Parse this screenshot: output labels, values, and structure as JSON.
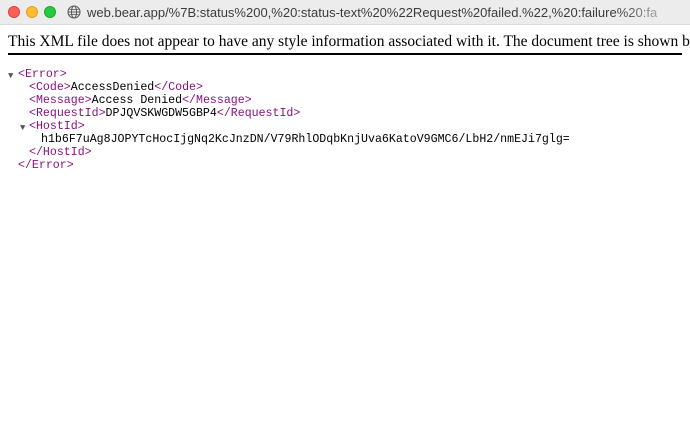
{
  "browser": {
    "url": "web.bear.app/%7B:status%200,%20:status-text%20%22Request%20failed.%22,%20:failure%20:fa",
    "icons": {
      "globe": "globe-icon"
    }
  },
  "page": {
    "notice": "This XML file does not appear to have any style information associated with it. The document tree is shown below."
  },
  "xml": {
    "error_open": "<Error>",
    "error_close": "</Error>",
    "code_open": "<Code>",
    "code_value": "AccessDenied",
    "code_close": "</Code>",
    "message_open": "<Message>",
    "message_value": "Access Denied",
    "message_close": "</Message>",
    "requestid_open": "<RequestId>",
    "requestid_value": "DPJQVSKWGDW5GBP4",
    "requestid_close": "</RequestId>",
    "hostid_open": "<HostId>",
    "hostid_value": "h1b6F7uAg8JOPYTcHocIjgNq2KcJnzDN/V79RhlODqbKnjUva6KatoV9GMC6/LbH2/nmEJi7glg=",
    "hostid_close": "</HostId>",
    "toggle_glyph": "▼"
  },
  "colors": {
    "tag": "#881280",
    "close_button": "#fe5f57",
    "minimize_button": "#febc2e",
    "zoom_button": "#28c840"
  }
}
